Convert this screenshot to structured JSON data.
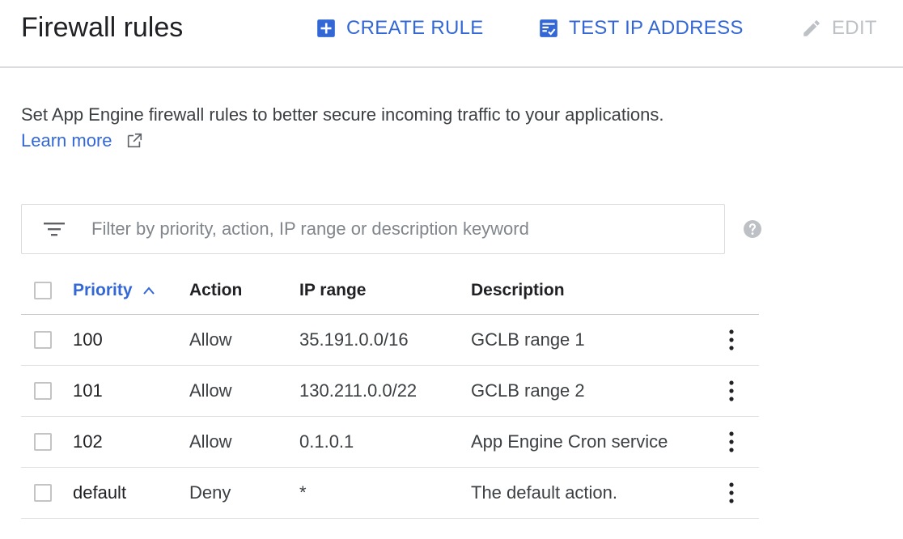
{
  "header": {
    "title": "Firewall rules",
    "create_label": "CREATE RULE",
    "test_label": "TEST IP ADDRESS",
    "edit_label": "EDIT"
  },
  "intro": {
    "text": "Set App Engine firewall rules to better secure incoming traffic to your applications.",
    "learn_more": "Learn more"
  },
  "filter": {
    "placeholder": "Filter by priority, action, IP range or description keyword",
    "value": ""
  },
  "table": {
    "columns": {
      "priority": "Priority",
      "action": "Action",
      "ip_range": "IP range",
      "description": "Description"
    },
    "sort": {
      "column": "priority",
      "direction": "ascending"
    },
    "rows": [
      {
        "priority": "100",
        "action": "Allow",
        "ip_range": "35.191.0.0/16",
        "description": "GCLB range 1"
      },
      {
        "priority": "101",
        "action": "Allow",
        "ip_range": "130.211.0.0/22",
        "description": "GCLB range 2"
      },
      {
        "priority": "102",
        "action": "Allow",
        "ip_range": "0.1.0.1",
        "description": "App Engine Cron service"
      },
      {
        "priority": "default",
        "action": "Deny",
        "ip_range": "*",
        "description": "The default action."
      }
    ]
  },
  "icons": {
    "create": "add-box-icon",
    "test": "checklist-icon",
    "edit": "pencil-icon",
    "external": "external-link-icon",
    "filter": "filter-list-icon",
    "help": "help-circle-icon",
    "sort": "chevron-up-icon",
    "row_menu": "more-vert-icon"
  },
  "colors": {
    "accent": "#3367d6",
    "disabled": "#bdc1c6",
    "divider": "#dadce0"
  }
}
